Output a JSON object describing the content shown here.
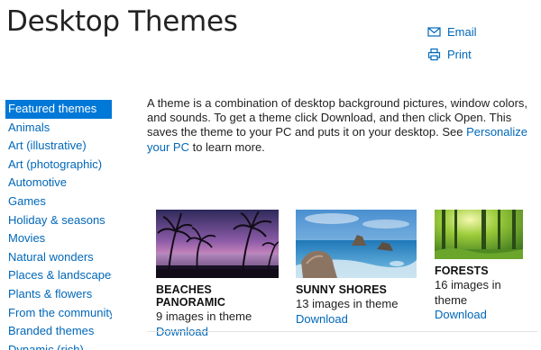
{
  "page": {
    "title": "Desktop Themes"
  },
  "share": {
    "email": "Email",
    "print": "Print"
  },
  "sidebar": {
    "items": [
      {
        "label": "Featured themes",
        "active": true
      },
      {
        "label": "Animals"
      },
      {
        "label": "Art (illustrative)"
      },
      {
        "label": "Art (photographic)"
      },
      {
        "label": "Automotive"
      },
      {
        "label": "Games"
      },
      {
        "label": "Holiday & seasons"
      },
      {
        "label": "Movies"
      },
      {
        "label": "Natural wonders"
      },
      {
        "label": "Places & landscapes"
      },
      {
        "label": "Plants & flowers"
      },
      {
        "label": "From the community"
      },
      {
        "label": "Branded themes"
      },
      {
        "label": "Dynamic (rich)"
      }
    ]
  },
  "intro": {
    "text_before": "A theme is a combination of desktop background pictures, window colors, and sounds. To get a theme click Download, and then click Open. This saves the theme to your PC and puts it on your desktop. See ",
    "link": "Personalize your PC",
    "text_after": " to learn more."
  },
  "themes": [
    {
      "name": "BEACHES PANORAMIC",
      "count": "9 images in theme",
      "download": "Download"
    },
    {
      "name": "SUNNY SHORES",
      "count": "13 images in theme",
      "download": "Download"
    },
    {
      "name": "FORESTS",
      "count": "16 images in theme",
      "download": "Download"
    }
  ],
  "colors": {
    "link": "#0067b8",
    "accent": "#0078d7"
  }
}
